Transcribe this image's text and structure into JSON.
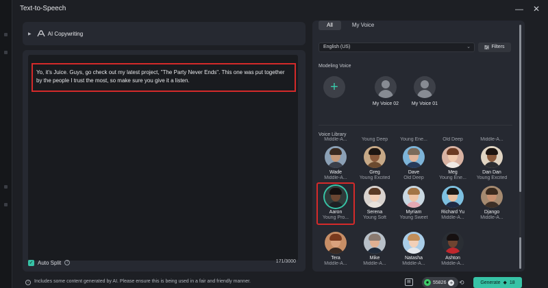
{
  "window": {
    "title": "Text-to-Speech",
    "minimize_glyph": "—",
    "close_glyph": "✕"
  },
  "copywriting": {
    "label": "AI Copywriting"
  },
  "editor": {
    "text": "Yo, it's Juice. Guys, go check out my latest project, \"The Party Never Ends\".  This one was put together by the people I trust the most, so make sure you give it a listen.",
    "auto_split_label": "Auto Split",
    "auto_split_checked": true,
    "char_count": "171/3000"
  },
  "tabs": [
    {
      "label": "All",
      "active": true
    },
    {
      "label": "My Voice",
      "active": false
    }
  ],
  "language": {
    "selected": "English (US)"
  },
  "filters_label": "Filters",
  "modeling": {
    "label": "Modeling Voice",
    "voices": [
      {
        "name": "My Voice 02"
      },
      {
        "name": "My Voice 01"
      }
    ]
  },
  "library": {
    "label": "Voice Library",
    "top_partial": [
      "Middle-A...",
      "Young Deep",
      "Young Ene...",
      "Old Deep",
      "Middle-A..."
    ],
    "rows": [
      [
        {
          "name": "Wade",
          "desc": "Middle-A...",
          "skin": "#c69a7a",
          "hair": "#3a2a20",
          "shirt": "#3a3f4a",
          "bg": "#8ba0b5"
        },
        {
          "name": "Greg",
          "desc": "Young Excited",
          "skin": "#8a5a3c",
          "hair": "#1e1612",
          "shirt": "#6b4a2f",
          "bg": "#c7a987"
        },
        {
          "name": "Dave",
          "desc": "Old Deep",
          "skin": "#e0b49a",
          "hair": "#7a6a5a",
          "shirt": "#263a5a",
          "bg": "#7db4d8"
        },
        {
          "name": "Meg",
          "desc": "Young Ene...",
          "skin": "#f0c9ad",
          "hair": "#6b3a22",
          "shirt": "#efe9e4",
          "bg": "#d8b2a2"
        },
        {
          "name": "Dan Dan",
          "desc": "Young Excited",
          "skin": "#8a5a3c",
          "hair": "#1c1410",
          "shirt": "#2a2c30",
          "bg": "#e0d4c2"
        }
      ],
      [
        {
          "name": "Aaron",
          "desc": "Young Pro...",
          "skin": "#6a4632",
          "hair": "#141010",
          "shirt": "#1d2024",
          "bg": "#2f3a3a",
          "selected": true
        },
        {
          "name": "Serena",
          "desc": "Young Soft",
          "skin": "#f2cfb8",
          "hair": "#5a3a26",
          "shirt": "#e8e2dc",
          "bg": "#d9d3cf"
        },
        {
          "name": "Myriam",
          "desc": "Young Sweet",
          "skin": "#f0c5a6",
          "hair": "#a27445",
          "shirt": "#e5a9b3",
          "bg": "#c9d8e2"
        },
        {
          "name": "Richard Yu",
          "desc": "Middle-A...",
          "skin": "#e8c0a0",
          "hair": "#1c1916",
          "shirt": "#1f2b45",
          "bg": "#7dc0e0"
        },
        {
          "name": "Django",
          "desc": "Middle-A...",
          "skin": "#c69070",
          "hair": "#3a2a1e",
          "shirt": "#3c2f26",
          "bg": "#a58a70"
        }
      ],
      [
        {
          "name": "Tera",
          "desc": "Middle-A...",
          "skin": "#d9a27e",
          "hair": "#7a3a1e",
          "shirt": "#3a2a22",
          "bg": "#c78e66"
        },
        {
          "name": "Mike",
          "desc": "Middle-A...",
          "skin": "#e0b092",
          "hair": "#8a7a70",
          "shirt": "#1f2a3a",
          "bg": "#b8c0c8"
        },
        {
          "name": "Natasha",
          "desc": "Middle-A...",
          "skin": "#f2d0b8",
          "hair": "#c28f5a",
          "shirt": "#e3e7ec",
          "bg": "#a9cde8"
        },
        {
          "name": "Ashton",
          "desc": "Middle-A...",
          "skin": "#6e4430",
          "hair": "#161010",
          "shirt": "#c0272d",
          "bg": "#2a2e34"
        }
      ]
    ]
  },
  "bottom": {
    "notice": "Includes some content generated by AI. Please ensure this is being used in a fair and friendly manner.",
    "credits": "55826",
    "generate_label": "Generate",
    "generate_cost": "18"
  },
  "colors": {
    "accent": "#37c3a6",
    "highlight_border": "#d62a2a",
    "panel": "#262931",
    "background": "#1d1f24"
  }
}
